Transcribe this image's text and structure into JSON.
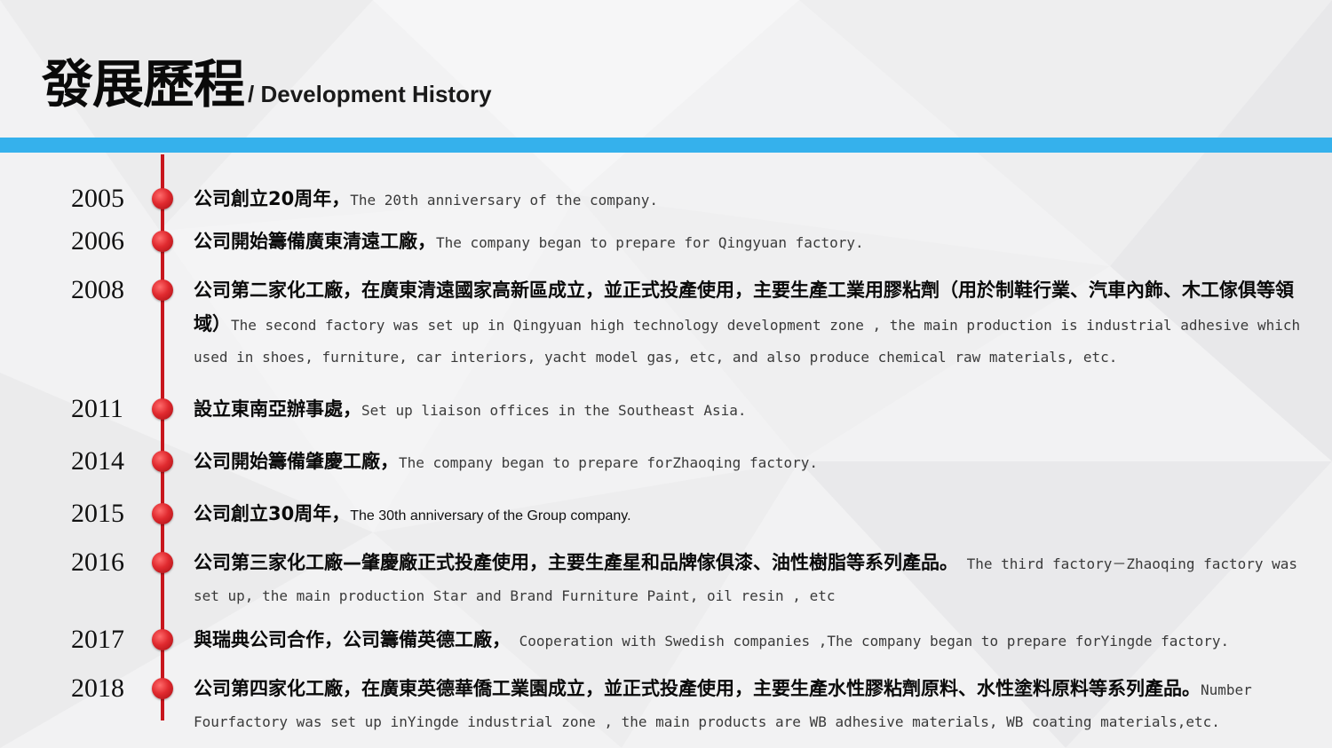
{
  "header": {
    "title_zh": "發展歷程",
    "title_en": "/ Development History"
  },
  "colors": {
    "accent_bar": "#35b1ec",
    "timeline_line": "#c8161d",
    "dot": "#e02a2f"
  },
  "events": [
    {
      "year": "2005",
      "zh": "公司創立20周年，",
      "en": "The 20th anniversary of the company."
    },
    {
      "year": "2006",
      "zh": "公司開始籌備廣東清遠工廠，",
      "en": "The company began to prepare for Qingyuan factory."
    },
    {
      "year": "2008",
      "zh": "公司第二家化工廠，在廣東清遠國家高新區成立，並正式投產使用，主要生產工業用膠粘劑（用於制鞋行業、汽車內飾、木工傢俱等領域）",
      "en": "The second factory was set up in Qingyuan high  technology development zone , the main production is industrial adhesive which used in shoes, furniture, car interiors, yacht model gas, etc, and also produce chemical raw materials, etc."
    },
    {
      "year": "2011",
      "zh": "設立東南亞辦事處，",
      "en": "Set up liaison offices in the Southeast Asia."
    },
    {
      "year": "2014",
      "zh": "公司開始籌備肇慶工廠，",
      "en": "The company began to prepare forZhaoqing factory."
    },
    {
      "year": "2015",
      "zh": "公司創立30周年，",
      "en": "The 30th anniversary of the Group company."
    },
    {
      "year": "2016",
      "zh": "公司第三家化工廠—肇慶廠正式投產使用，主要生產星和品牌傢俱漆、油性樹脂等系列產品。",
      "en": " The third factory－Zhaoqing factory was set up, the main production Star and Brand Furniture Paint, oil resin , etc"
    },
    {
      "year": "2017",
      "zh": "與瑞典公司合作，公司籌備英德工廠，",
      "en": " Cooperation with Swedish companies ,The company began to prepare forYingde factory."
    },
    {
      "year": "2018",
      "zh": "公司第四家化工廠，在廣東英德華僑工業園成立，並正式投產使用，主要生產水性膠粘劑原料、水性塗料原料等系列產品。",
      "en": "Number Fourfactory was set up inYingde industrial zone , the main products are WB adhesive materials, WB coating materials,etc."
    }
  ]
}
